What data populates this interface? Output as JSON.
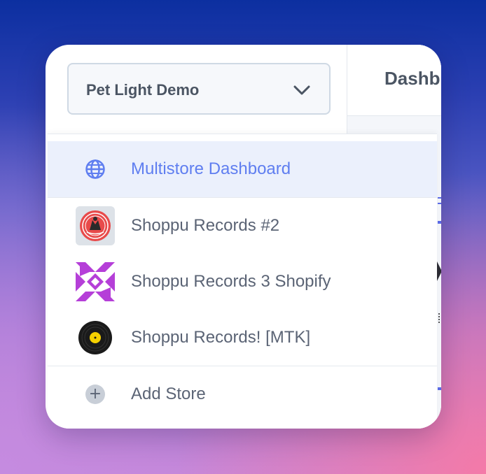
{
  "header": {
    "title": "Dashb"
  },
  "store_selector": {
    "current_store": "Pet Light Demo",
    "chevron_icon": "chevron-down-icon"
  },
  "dropdown": {
    "items": [
      {
        "label": "Multistore Dashboard",
        "icon": "globe-icon",
        "selected": true
      },
      {
        "label": "Shoppu Records #2",
        "icon": "shoppu-records-2-logo",
        "selected": false
      },
      {
        "label": "Shoppu Records 3 Shopify",
        "icon": "shoppu-records-3-logo",
        "selected": false
      },
      {
        "label": "Shoppu Records! [MTK]",
        "icon": "vinyl-record-icon",
        "selected": false
      }
    ],
    "add_store": {
      "label": "Add Store",
      "icon": "plus-circle-icon"
    }
  },
  "colors": {
    "accent": "#5f7ef0",
    "selected_bg": "#ebf0fc",
    "text": "#5b6475",
    "brand_purple": "#b53fd8",
    "brand_red": "#e84a4a",
    "vinyl_yellow": "#f4d000"
  }
}
